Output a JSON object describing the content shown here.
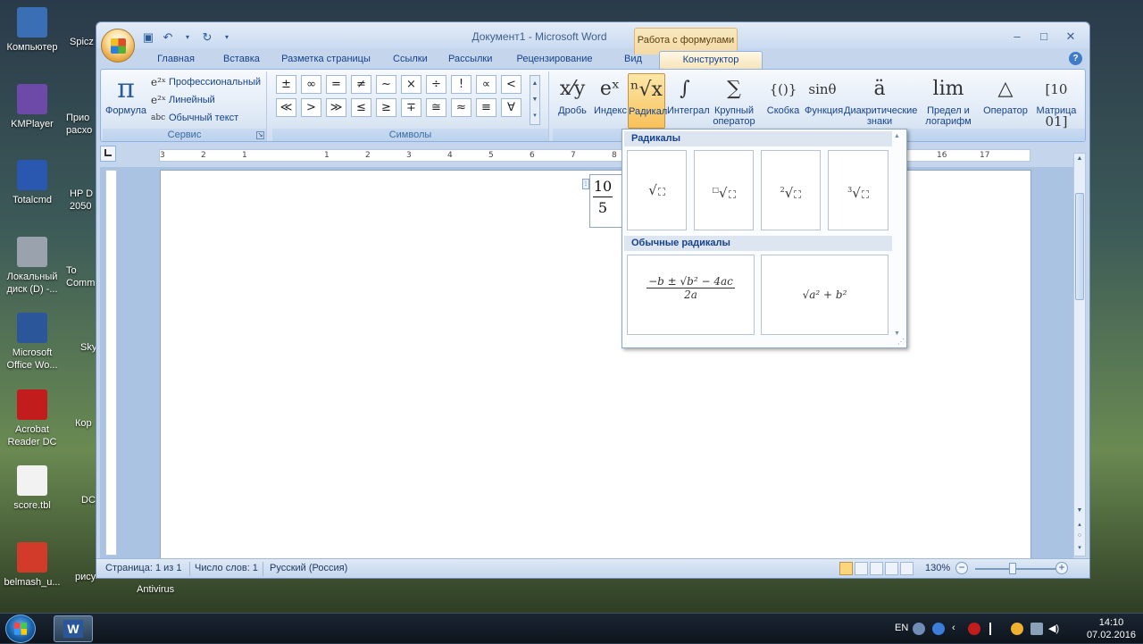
{
  "desktop": {
    "icons": [
      {
        "label": "Компьютер",
        "color": "#3b6fb5"
      },
      {
        "label": "KMPlayer",
        "color": "#6e4aa8"
      },
      {
        "label": "Totalcmd",
        "color": "#2a58b0"
      },
      {
        "label": "Локальный диск (D) -...",
        "color": "#9aa3ad"
      },
      {
        "label": "Microsoft Office Wo...",
        "color": "#2b579a"
      },
      {
        "label": "Acrobat Reader DC",
        "color": "#c21c1c"
      },
      {
        "label": "score.tbl",
        "color": "#f2f2f2"
      },
      {
        "label": "belmash_u...",
        "color": "#d23a2a"
      }
    ],
    "partial_labels": [
      "Spicz",
      "Прио расхо",
      "HP D 2050",
      "To Comm",
      "Sky",
      "Кор",
      "DC",
      "рису"
    ],
    "antivirus_label": "Antivirus"
  },
  "window": {
    "title": "Документ1 - Microsoft Word",
    "context_tab_group": "Работа с формулами",
    "controls": {
      "minimize": "–",
      "maximize": "□",
      "close": "✕"
    }
  },
  "tabs": [
    "Главная",
    "Вставка",
    "Разметка страницы",
    "Ссылки",
    "Рассылки",
    "Рецензирование",
    "Вид",
    "Конструктор"
  ],
  "ribbon": {
    "service": {
      "label": "Сервис",
      "formula_button": "Формула",
      "formula_glyph": "π",
      "options": [
        {
          "icon": "e²ˣ",
          "label": "Профессиональный"
        },
        {
          "icon": "e²ˣ",
          "label": "Линейный"
        },
        {
          "icon": "abc",
          "label": "Обычный текст"
        }
      ]
    },
    "symbols": {
      "label": "Символы",
      "row1": [
        "±",
        "∞",
        "=",
        "≠",
        "~",
        "×",
        "÷",
        "!",
        "∝",
        "<"
      ],
      "row2": [
        "≪",
        ">",
        "≫",
        "≤",
        "≥",
        "∓",
        "≅",
        "≈",
        "≡",
        "∀"
      ]
    },
    "structures": [
      {
        "glyph": "x⁄y",
        "label": "Дробь"
      },
      {
        "glyph": "eˣ",
        "label": "Индекс"
      },
      {
        "glyph": "ⁿ√x",
        "label": "Радикал"
      },
      {
        "glyph": "∫",
        "label": "Интеграл"
      },
      {
        "glyph": "∑",
        "label": "Крупный оператор"
      },
      {
        "glyph": "{()}",
        "label": "Скобка"
      },
      {
        "glyph": "sinθ",
        "label": "Функция"
      },
      {
        "glyph": "ä",
        "label": "Диакритические знаки"
      },
      {
        "glyph": "lim",
        "label": "Предел и логарифм"
      },
      {
        "glyph": "△",
        "label": "Оператор"
      },
      {
        "glyph": "[10 01]",
        "label": "Матрица"
      }
    ]
  },
  "document": {
    "equation": {
      "numerator": "10",
      "denominator": "5"
    }
  },
  "ruler_numbers": [
    "3",
    "2",
    "1",
    "1",
    "2",
    "3",
    "4",
    "5",
    "6",
    "7",
    "8",
    "16",
    "17"
  ],
  "gallery": {
    "section1": "Радикалы",
    "section2": "Обычные радикалы",
    "radicals": [
      {
        "index": ""
      },
      {
        "index": "□"
      },
      {
        "index": "2"
      },
      {
        "index": "3"
      }
    ],
    "common": [
      "−b ± √b² − 4ac",
      "2a",
      "√a² + b²"
    ]
  },
  "statusbar": {
    "page": "Страница: 1 из 1",
    "words": "Число слов: 1",
    "language": "Русский (Россия)",
    "zoom": "130%",
    "zoom_minus": "−",
    "zoom_plus": "+"
  },
  "tray": {
    "language": "EN",
    "time": "14:10",
    "date": "07.02.2016"
  }
}
